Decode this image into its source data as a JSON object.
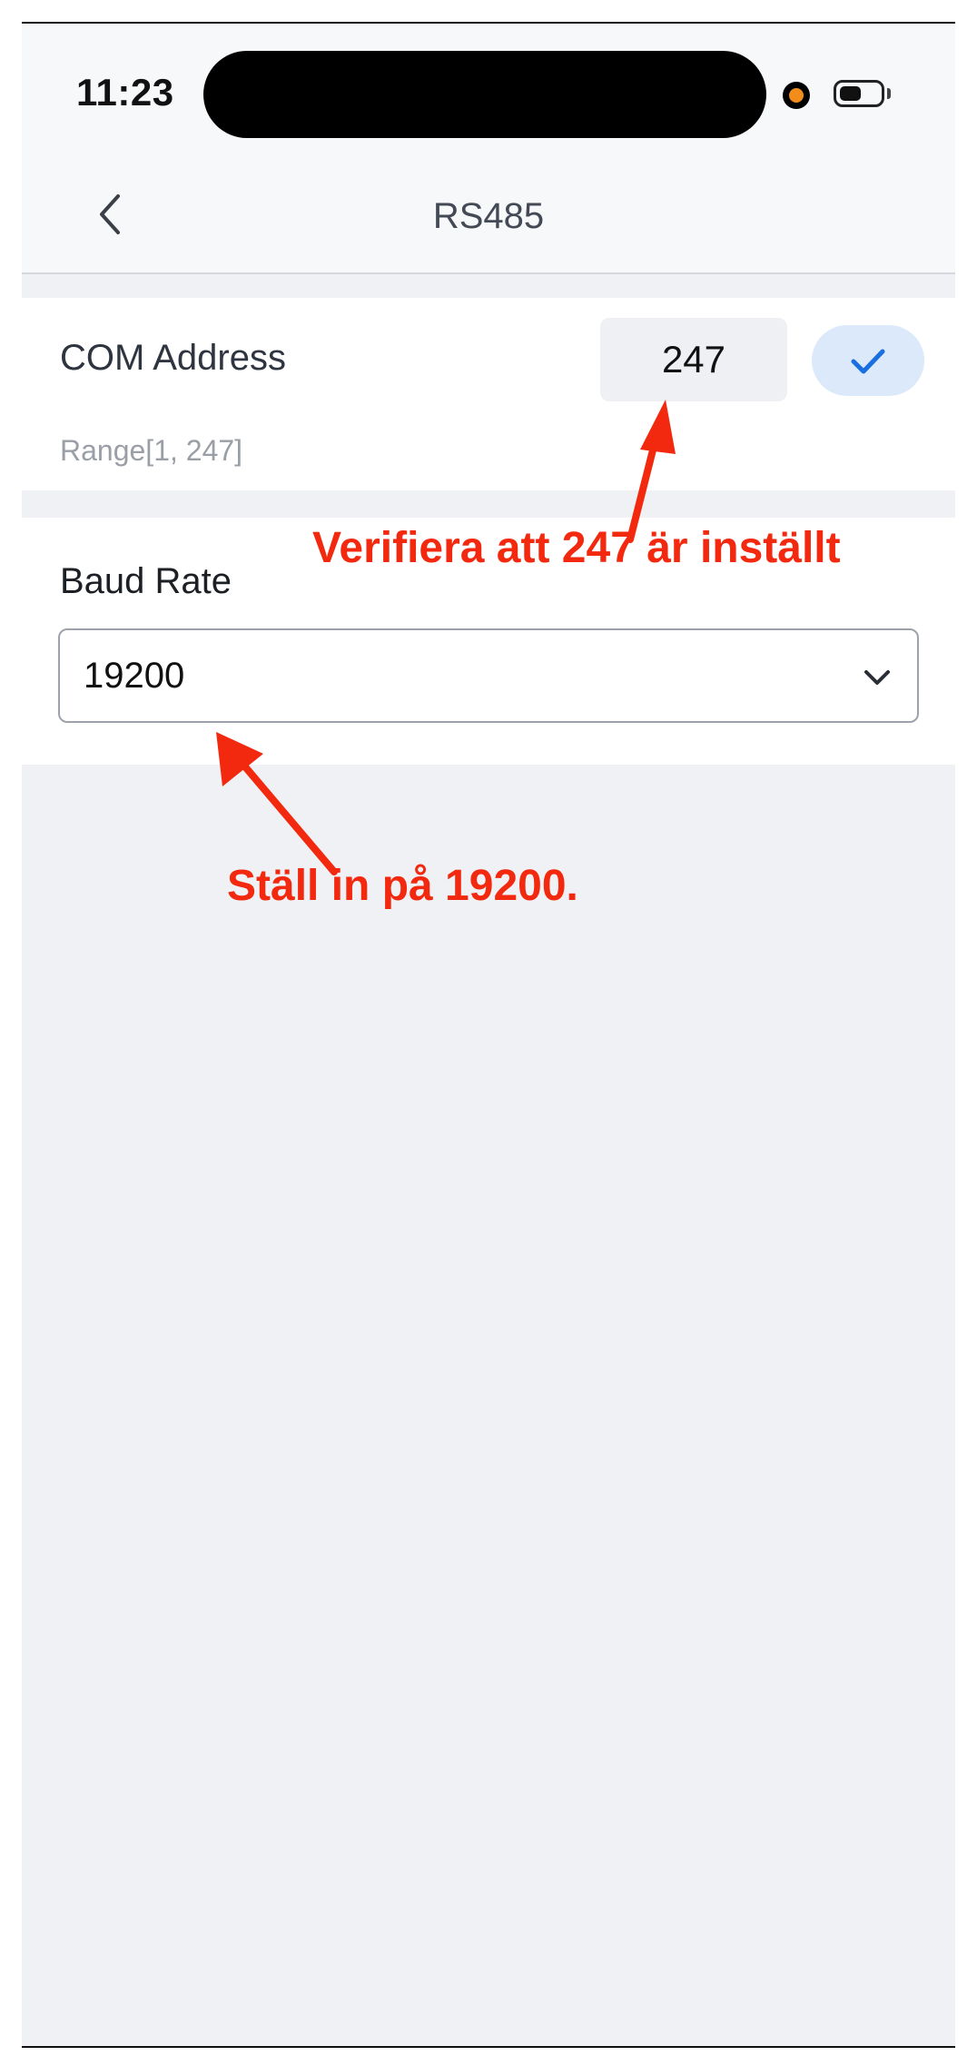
{
  "status_bar": {
    "time": "11:23",
    "battery_level": 0.55,
    "privacy_indicator_color": "#f28c1a"
  },
  "nav": {
    "title": "RS485",
    "back_icon": "chevron-left-icon"
  },
  "com_address": {
    "label": "COM Address",
    "value": "247",
    "range_hint": "Range[1, 247]",
    "confirm_icon": "checkmark-icon"
  },
  "baud_rate": {
    "label": "Baud Rate",
    "selected": "19200",
    "dropdown_icon": "chevron-down-icon"
  },
  "annotations": {
    "com_note": "Verifiera att 247 är inställt",
    "baud_note": "Ställ in på 19200."
  },
  "colors": {
    "annotation": "#f2290e",
    "accent": "#1a6fe0",
    "confirm_bg": "#dbe9fb"
  }
}
